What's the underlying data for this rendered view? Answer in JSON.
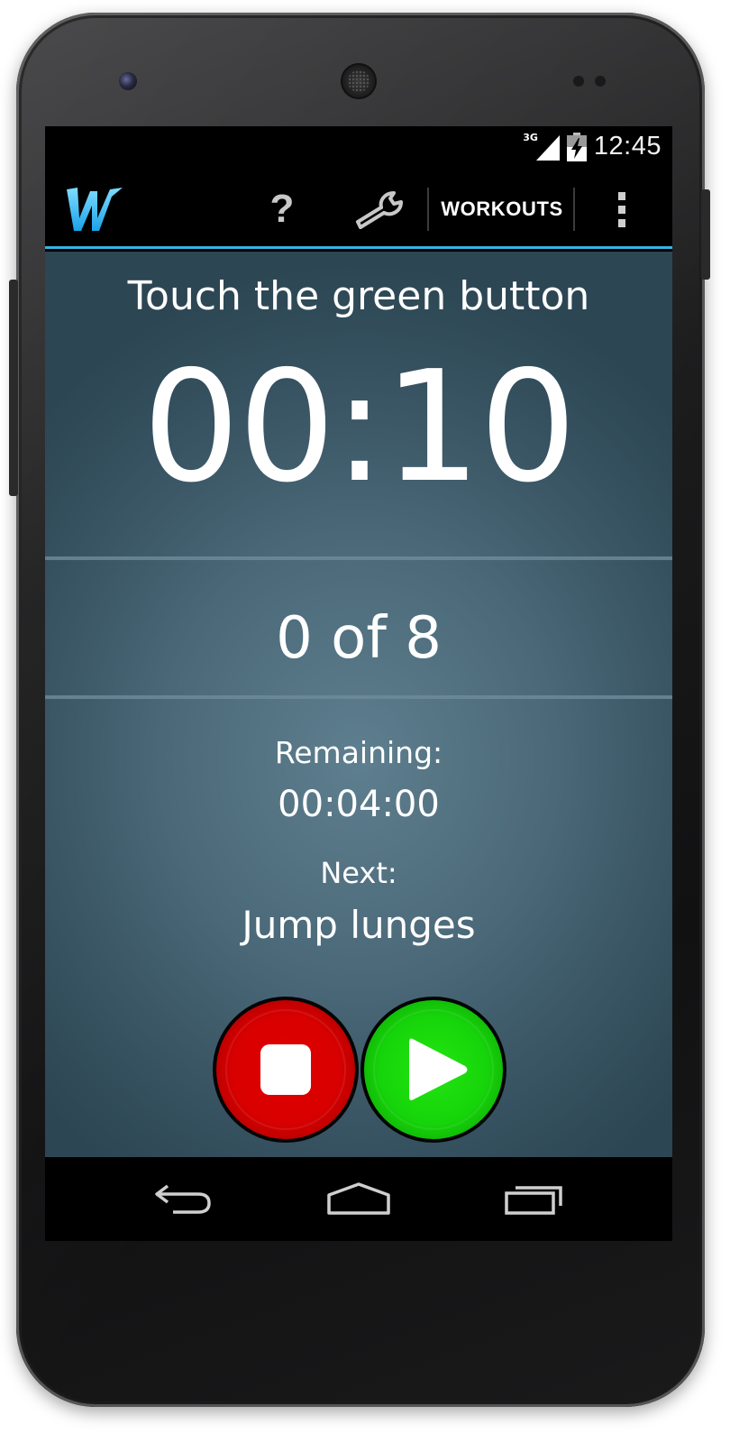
{
  "status_bar": {
    "network_type": "3G",
    "time": "12:45",
    "icons": [
      "signal-icon",
      "battery-charging-icon"
    ]
  },
  "action_bar": {
    "logo_icon": "app-logo-w-icon",
    "help_label": "?",
    "settings_icon": "wrench-icon",
    "workouts_label": "WORKOUTS",
    "overflow_icon": "overflow-menu-icon",
    "accent_color": "#33b5e5"
  },
  "main": {
    "prompt": "Touch the green button",
    "timer": "00:10",
    "counter": "0 of 8",
    "remaining_label": "Remaining:",
    "remaining_value": "00:04:00",
    "next_label": "Next:",
    "next_value": "Jump lunges"
  },
  "controls": {
    "stop_icon": "stop-icon",
    "stop_color": "#d80000",
    "play_icon": "play-icon",
    "play_color": "#16d40a"
  },
  "nav_bar": {
    "icons": [
      "back-icon",
      "home-icon",
      "recent-apps-icon"
    ]
  }
}
